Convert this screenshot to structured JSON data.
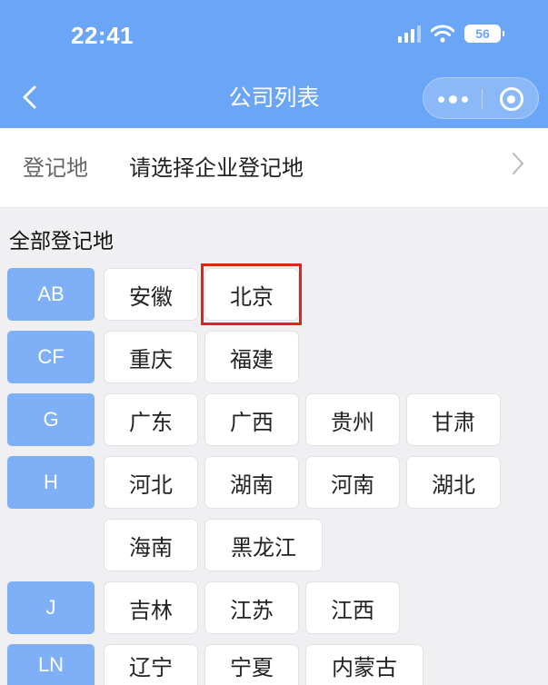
{
  "status_bar": {
    "time": "22:41",
    "battery": "56"
  },
  "nav": {
    "title": "公司列表"
  },
  "filter": {
    "label": "登记地",
    "placeholder": "请选择企业登记地"
  },
  "section": {
    "title": "全部登记地"
  },
  "groups": [
    {
      "letter": "AB",
      "regions": [
        "安徽",
        "北京"
      ]
    },
    {
      "letter": "CF",
      "regions": [
        "重庆",
        "福建"
      ]
    },
    {
      "letter": "G",
      "regions": [
        "广东",
        "广西",
        "贵州",
        "甘肃"
      ]
    },
    {
      "letter": "H",
      "regions": [
        "河北",
        "湖南",
        "河南",
        "湖北",
        "海南",
        "黑龙江"
      ]
    },
    {
      "letter": "J",
      "regions": [
        "吉林",
        "江苏",
        "江西"
      ]
    },
    {
      "letter": "LN",
      "regions": [
        "辽宁",
        "宁夏",
        "内蒙古"
      ]
    }
  ],
  "highlighted_region": "北京",
  "colors": {
    "header": "#6aa5f6",
    "badge": "#7fb0f7",
    "highlight": "#e02418"
  }
}
